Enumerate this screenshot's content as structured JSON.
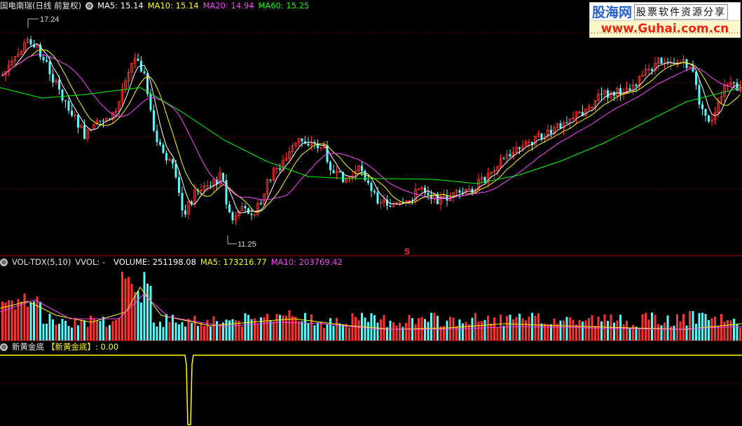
{
  "main_header": {
    "title": "国电南瑞(日线 前复权)",
    "ma5": "MA5: 15.14",
    "ma10": "MA10: 15.14",
    "ma20": "MA20: 14.94",
    "ma60": "MA60: 15.25"
  },
  "high_label": "17.24",
  "low_label": "11.25",
  "s_marker": "S",
  "vol_header": {
    "title": "VOL-TDX(5,10)",
    "vvol": "VVOL: -",
    "volume": "VOLUME: 251198.08",
    "ma5": "MA5: 173216.77",
    "ma10": "MA10: 203769.42"
  },
  "ind_header": {
    "title": "新黄金底",
    "tag": "【新黄金底】",
    "value": ": 0.00"
  },
  "watermark": {
    "logo": "股海网",
    "tagline": "股票软件资源分享",
    "url": "www.Guhai.com.cn"
  },
  "colors": {
    "up": "#ff3232",
    "down": "#54ffff",
    "ma5": "#ffffff",
    "ma10": "#ffff00",
    "ma20": "#ff44ff",
    "ma60": "#00ff00",
    "divider": "#b80000",
    "indicator": "#ffff00"
  },
  "icons": [
    "settings-circle-icon"
  ]
}
